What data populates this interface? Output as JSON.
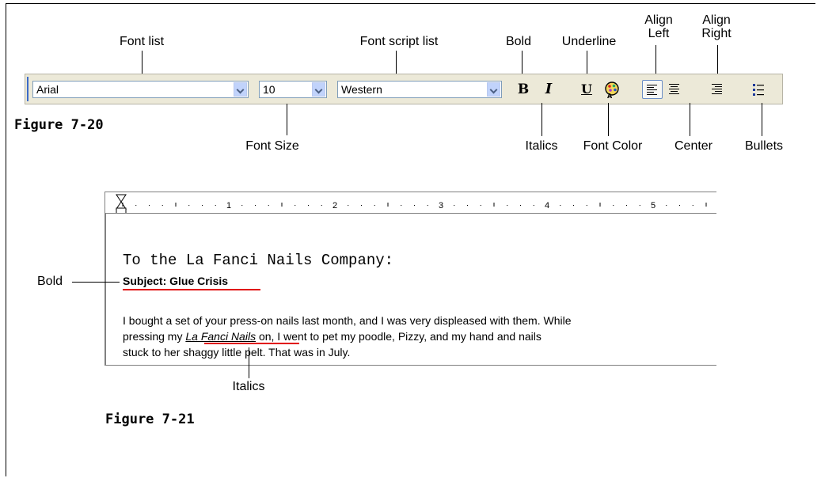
{
  "callouts": {
    "font_list": "Font list",
    "font_script_list": "Font script list",
    "bold": "Bold",
    "underline": "Underline",
    "align_left": "Align\nLeft",
    "align_right": "Align\nRight",
    "font_size": "Font Size",
    "italics": "Italics",
    "font_color": "Font Color",
    "center": "Center",
    "bullets": "Bullets",
    "doc_bold": "Bold",
    "doc_italics": "Italics"
  },
  "figures": {
    "fig1": "Figure 7-20",
    "fig2": "Figure 7-21"
  },
  "toolbar": {
    "font_value": "Arial",
    "size_value": "10",
    "script_value": "Western",
    "bold_glyph": "B",
    "italic_glyph": "I",
    "underline_glyph": "U"
  },
  "ruler": {
    "numbers": [
      "1",
      "2",
      "3",
      "4",
      "5"
    ]
  },
  "document": {
    "greeting": "To the La Fanci Nails Company:",
    "subject": "Subject: Glue Crisis",
    "p1_line1": "I bought a set of your press-on nails last month, and I was very displeased with them. While",
    "p1_line2_pre": "pressing my ",
    "p1_line2_italic": "La Fanci Nails",
    "p1_line2_post": " on, I went to pet my poodle, Pizzy, and my hand and nails",
    "p1_line3": "stuck to her shaggy little pelt. That was in July."
  },
  "colors": {
    "toolbar_bg": "#ece9d8",
    "combo_border": "#7f9db9",
    "highlight_red": "#e00000"
  }
}
